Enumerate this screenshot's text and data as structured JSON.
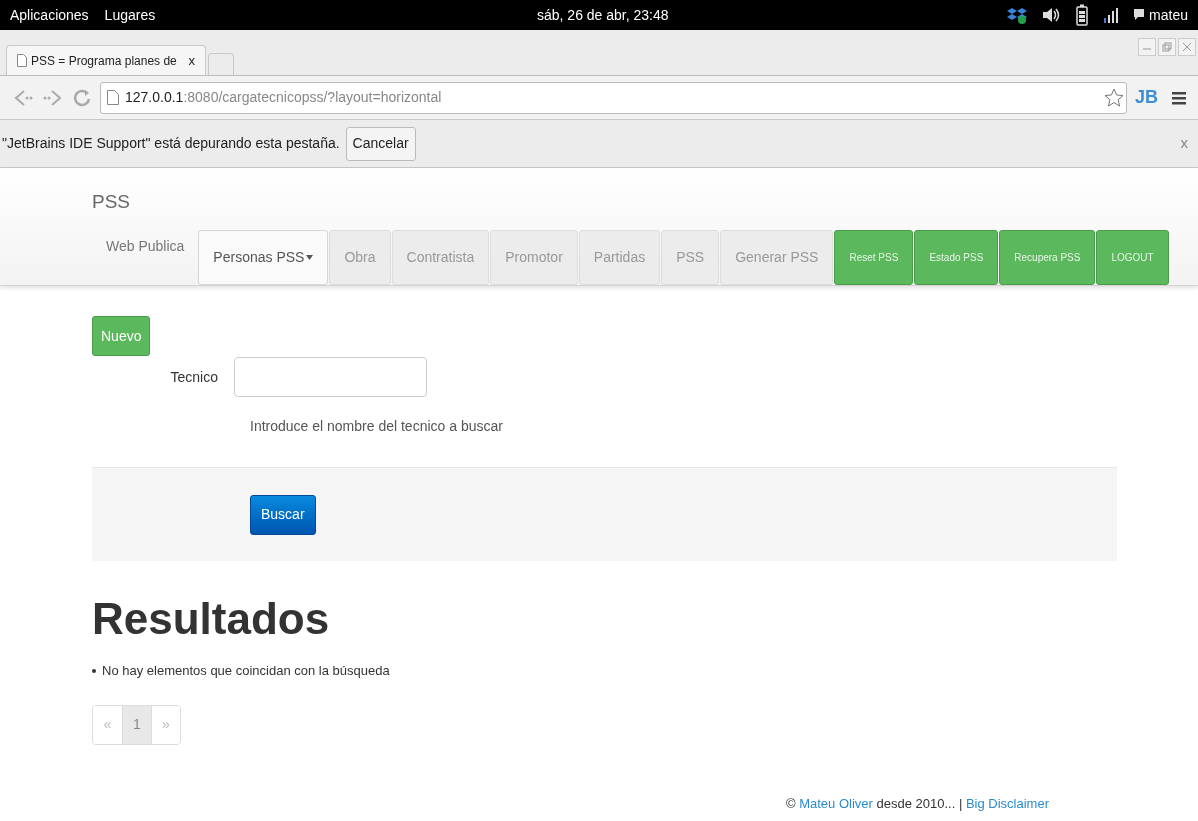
{
  "top_panel": {
    "menus": [
      "Aplicaciones",
      "Lugares"
    ],
    "clock": "sáb, 26 de abr, 23:48",
    "user": "mateu"
  },
  "browser": {
    "tab_title": "PSS = Programa planes de",
    "tab_close": "x",
    "url_host": "127.0.0.1",
    "url_rest": ":8080/cargatecnicopss/?layout=horizontal",
    "extension_label": "JB"
  },
  "infobar": {
    "message": "\"JetBrains IDE Support\" está depurando esta pestaña.",
    "button": "Cancelar",
    "close": "x"
  },
  "navbar": {
    "brand": "PSS",
    "items": [
      {
        "kind": "link",
        "label": "Web Publica"
      },
      {
        "kind": "dropdown",
        "label": "Personas PSS"
      },
      {
        "kind": "tab",
        "label": "Obra"
      },
      {
        "kind": "tab",
        "label": "Contratista"
      },
      {
        "kind": "tab",
        "label": "Promotor"
      },
      {
        "kind": "tab",
        "label": "Partidas"
      },
      {
        "kind": "tab",
        "label": "PSS"
      },
      {
        "kind": "tab",
        "label": "Generar PSS"
      },
      {
        "kind": "action",
        "label": "Reset PSS"
      },
      {
        "kind": "action",
        "label": "Estado PSS"
      },
      {
        "kind": "action",
        "label": "Recupera PSS"
      },
      {
        "kind": "action",
        "label": "LOGOUT"
      }
    ]
  },
  "page": {
    "new_button": "Nuevo",
    "field_label": "Tecnico",
    "help_text": "Introduce el nombre del tecnico a buscar",
    "search_button": "Buscar",
    "results_heading": "Resultados",
    "results": [
      "No hay elementos que coincidan con la búsqueda"
    ],
    "pagination": [
      {
        "label": "«",
        "selected": false
      },
      {
        "label": "1",
        "selected": true
      },
      {
        "label": "»",
        "selected": false
      }
    ]
  },
  "footer": {
    "copyright": "©",
    "author_link": "Mateu Oliver",
    "middle": "desde 2010... |",
    "disclaimer_link": "Big Disclaimer"
  }
}
